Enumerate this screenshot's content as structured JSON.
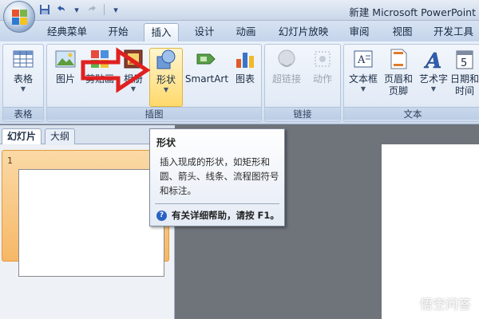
{
  "window": {
    "title": "新建 Microsoft PowerPoint"
  },
  "quick_access": {
    "items": [
      "save-icon",
      "undo-icon",
      "redo-icon",
      "customize-icon"
    ]
  },
  "tabs": [
    {
      "label": "经典菜单",
      "active": false
    },
    {
      "label": "开始",
      "active": false
    },
    {
      "label": "插入",
      "active": true
    },
    {
      "label": "设计",
      "active": false
    },
    {
      "label": "动画",
      "active": false
    },
    {
      "label": "幻灯片放映",
      "active": false
    },
    {
      "label": "审阅",
      "active": false
    },
    {
      "label": "视图",
      "active": false
    },
    {
      "label": "开发工具",
      "active": false
    }
  ],
  "ribbon": {
    "groups": {
      "table": {
        "label": "表格",
        "buttons": {
          "table": "表格"
        }
      },
      "illustrations": {
        "label": "插图",
        "buttons": {
          "picture": "图片",
          "clipart": "剪贴画",
          "album": "相册",
          "shapes": "形状",
          "smartart": "SmartArt",
          "chart": "图表"
        }
      },
      "links": {
        "label": "链接",
        "buttons": {
          "hyperlink": "超链接",
          "action": "动作"
        }
      },
      "text": {
        "label": "文本",
        "buttons": {
          "textbox": "文本框",
          "header_footer_1": "页眉和",
          "header_footer_2": "页脚",
          "wordart": "艺术字",
          "datetime_1": "日期和",
          "datetime_2": "时间"
        }
      }
    }
  },
  "left_pane": {
    "tabs": [
      {
        "label": "幻灯片",
        "active": true
      },
      {
        "label": "大纲",
        "active": false
      }
    ],
    "slides": [
      {
        "number": "1"
      }
    ]
  },
  "tooltip": {
    "title": "形状",
    "body": "插入现成的形状，如矩形和圆、箭头、线条、流程图符号和标注。",
    "help": "有关详细帮助，请按 F1。"
  },
  "watermark": {
    "text": "悟空问答"
  },
  "colors": {
    "ribbon_bg": "#dde7f4",
    "hover_highlight": "#ffd96b",
    "annotation_red": "#e02020",
    "slide_selected": "#f6b867",
    "workspace": "#6f737a"
  }
}
